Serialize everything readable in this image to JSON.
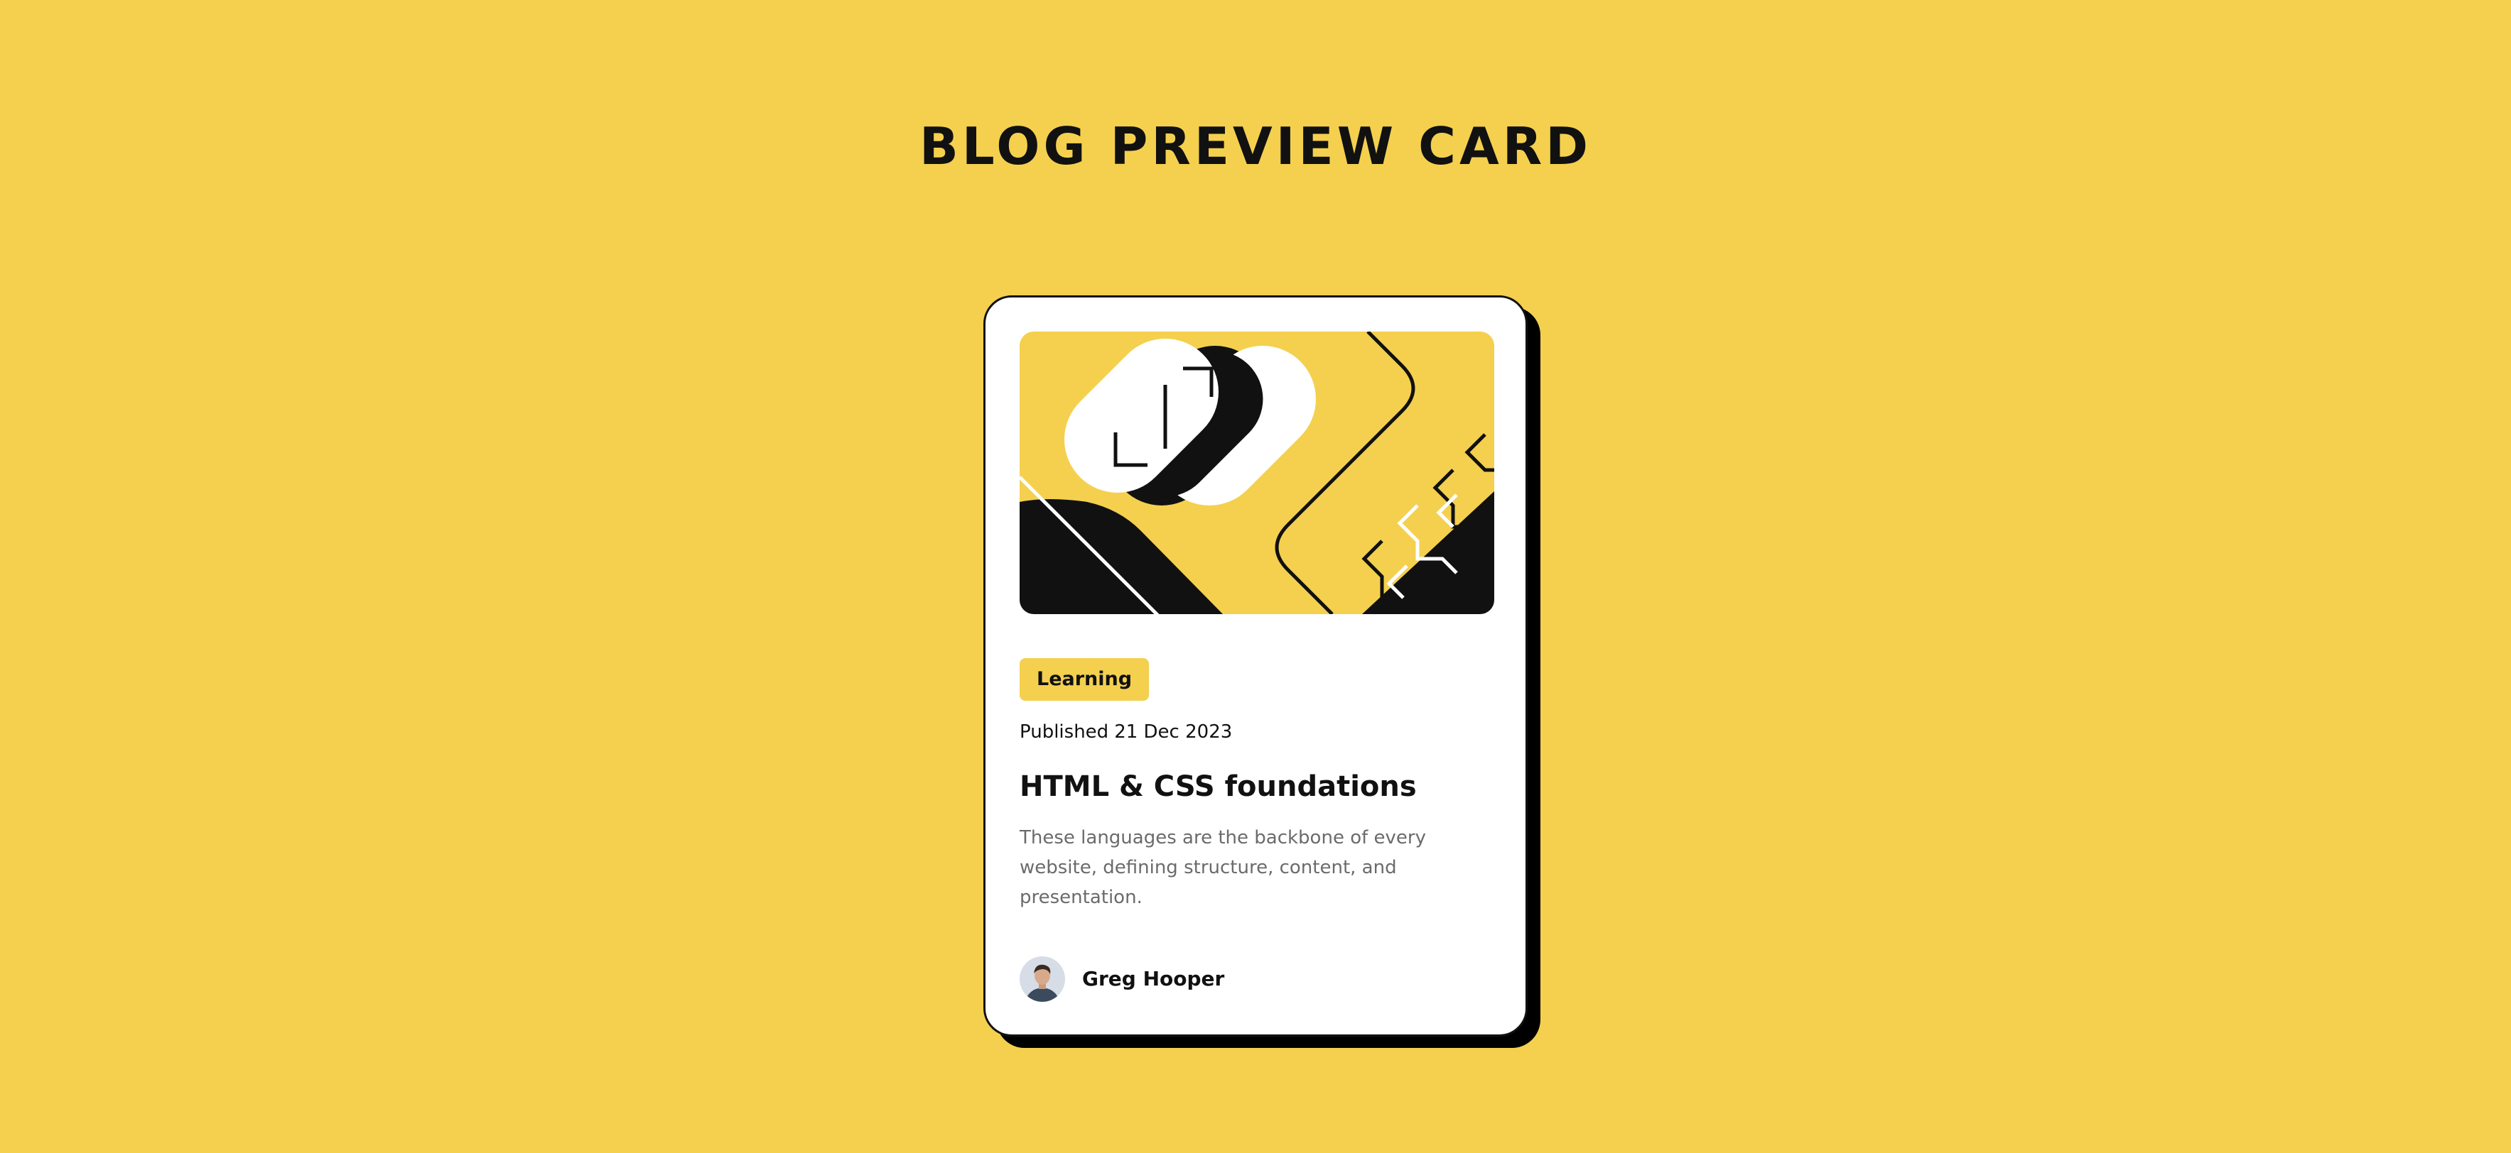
{
  "page": {
    "heading": "BLOG PREVIEW CARD"
  },
  "card": {
    "illustration": {
      "icon": "illustration-article-image",
      "colors": {
        "yellow": "#f4d04e",
        "black": "#111111",
        "white": "#ffffff"
      }
    },
    "tag": "Learning",
    "published_label": "Published",
    "published_date": "21 Dec 2023",
    "title": "HTML & CSS foundations",
    "description": "These languages are the backbone of every website, defining structure, content, and presentation.",
    "author": {
      "name": "Greg Hooper",
      "avatar_icon": "author-avatar"
    }
  },
  "colors": {
    "background": "#f4d04e",
    "card": "#ffffff",
    "text": "#111111",
    "muted_text": "#6b6b6b",
    "tag_background": "#f4d04e",
    "shadow": "#000000"
  }
}
